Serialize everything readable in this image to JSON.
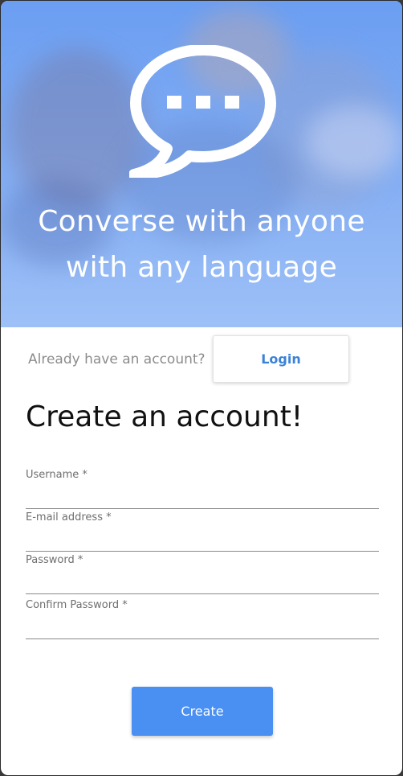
{
  "hero": {
    "icon": "speech-bubble-ellipsis-icon",
    "title_line1": "Converse with anyone",
    "title_line2": "with any language",
    "colors": {
      "top": "#6b9ef2",
      "bottom": "#9dc0f7"
    }
  },
  "login_prompt": {
    "text": "Already have an account?",
    "button_label": "Login"
  },
  "form": {
    "title": "Create an account!",
    "fields": [
      {
        "label": "Username *",
        "value": ""
      },
      {
        "label": "E-mail address *",
        "value": ""
      },
      {
        "label": "Password *",
        "value": ""
      },
      {
        "label": "Confirm Password *",
        "value": ""
      }
    ],
    "submit_label": "Create"
  },
  "colors": {
    "accent": "#4a8ff2",
    "link": "#3b82d6"
  }
}
